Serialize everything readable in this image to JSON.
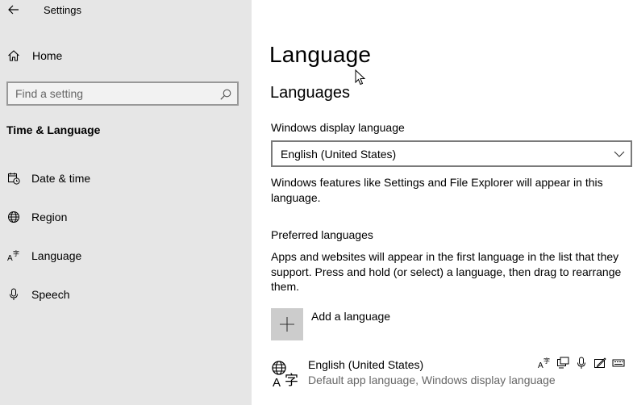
{
  "window": {
    "title": "Settings"
  },
  "sidebar": {
    "home_label": "Home",
    "search": {
      "placeholder": "Find a setting"
    },
    "section_title": "Time & Language",
    "items": [
      {
        "label": "Date & time",
        "icon": "calendar-clock-icon"
      },
      {
        "label": "Region",
        "icon": "globe-icon"
      },
      {
        "label": "Language",
        "icon": "language-icon"
      },
      {
        "label": "Speech",
        "icon": "microphone-icon"
      }
    ]
  },
  "main": {
    "title": "Language",
    "languages_heading": "Languages",
    "display_language": {
      "label": "Windows display language",
      "selected": "English (United States)",
      "description": "Windows features like Settings and File Explorer will appear in this language."
    },
    "preferred": {
      "label": "Preferred languages",
      "description": "Apps and websites will appear in the first language in the list that they support. Press and hold (or select) a language, then drag to rearrange them.",
      "add_label": "Add a language",
      "languages": [
        {
          "name": "English (United States)",
          "detail": "Default app language, Windows display language",
          "feature_icons": [
            "language-pack-icon",
            "text-to-speech-icon",
            "speech-recognition-icon",
            "handwriting-icon",
            "keyboard-icon"
          ]
        }
      ]
    }
  }
}
